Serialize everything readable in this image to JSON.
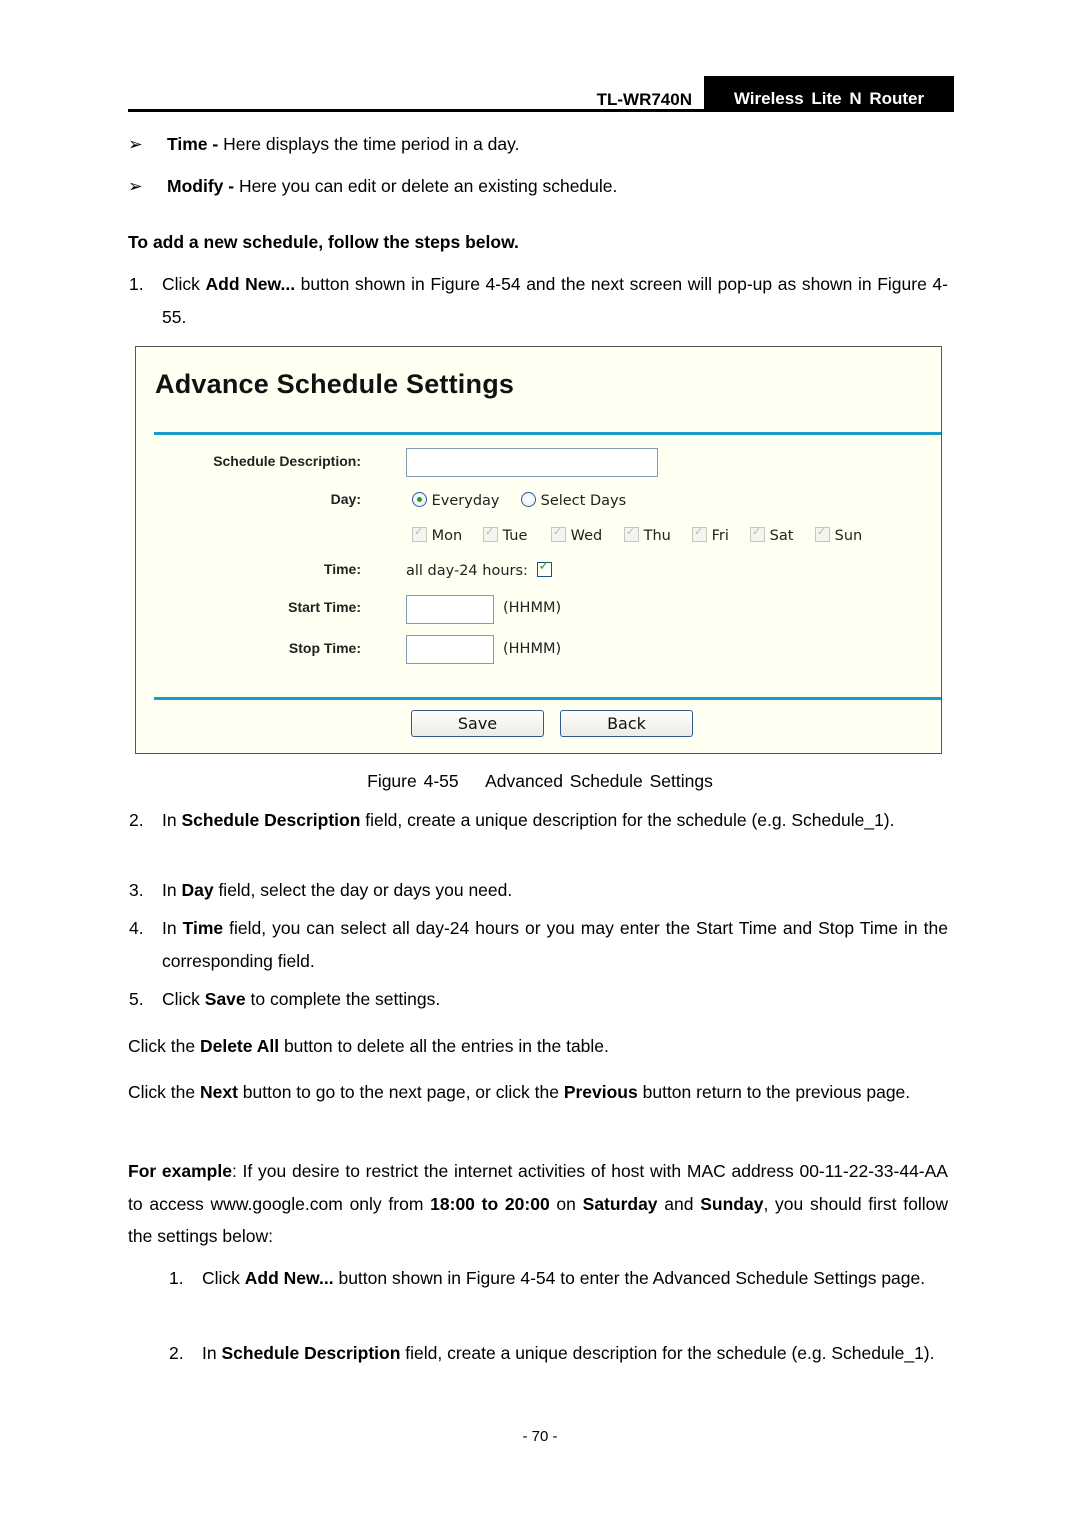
{
  "header": {
    "model": "TL-WR740N",
    "product": "Wireless  Lite  N  Router"
  },
  "bullets": [
    {
      "icon": "arrow-bullet-icon",
      "term": "Time -",
      "text": " Here displays the time period in a day."
    },
    {
      "icon": "arrow-bullet-icon",
      "term": "Modify -",
      "text": " Here you can edit or delete an existing schedule."
    }
  ],
  "section_heading": "To add a new schedule, follow the steps below.",
  "steps": [
    {
      "num": "1.",
      "parts": [
        "Click ",
        "Add New...",
        " button shown in Figure 4-54 and the next screen will pop-up as shown in Figure 4-55."
      ]
    },
    {
      "num": "2.",
      "parts": [
        "In ",
        "Schedule Description",
        " field, create a unique description for the schedule (e.g. Schedule_1)."
      ]
    },
    {
      "num": "3.",
      "parts": [
        "In ",
        "Day",
        " field, select the day or days you need."
      ]
    },
    {
      "num": "4.",
      "parts": [
        "In ",
        "Time",
        " field, you can select all day-24 hours or you may enter the Start Time and Stop Time in the corresponding field."
      ]
    },
    {
      "num": "5.",
      "parts": [
        "Click ",
        "Save",
        " to complete the settings."
      ]
    }
  ],
  "figure": {
    "title": "Advance Schedule Settings",
    "labels": {
      "description": "Schedule Description:",
      "day": "Day:",
      "time": "Time:",
      "start": "Start Time:",
      "stop": "Stop Time:"
    },
    "description_value": "",
    "day_options": [
      {
        "label": "Everyday",
        "selected": true
      },
      {
        "label": "Select Days",
        "selected": false
      }
    ],
    "days": [
      {
        "label": "Mon",
        "checked": true,
        "disabled": true
      },
      {
        "label": "Tue",
        "checked": true,
        "disabled": true
      },
      {
        "label": "Wed",
        "checked": true,
        "disabled": true
      },
      {
        "label": "Thu",
        "checked": true,
        "disabled": true
      },
      {
        "label": "Fri",
        "checked": true,
        "disabled": true
      },
      {
        "label": "Sat",
        "checked": true,
        "disabled": true
      },
      {
        "label": "Sun",
        "checked": true,
        "disabled": true
      }
    ],
    "all_day_label": "all day-24 hours:",
    "all_day_checked": true,
    "start_value": "",
    "stop_value": "",
    "time_format_hint": "(HHMM)",
    "buttons": {
      "save": "Save",
      "back": "Back"
    },
    "colors": {
      "background": "#fffff2",
      "divider": "#1a9bc9"
    }
  },
  "caption": "Figure 4-55    Advanced Schedule Settings",
  "paragraphs": {
    "delete_all": [
      "Click the ",
      "Delete All",
      " button to delete all the entries in the table."
    ],
    "next_prev": [
      "Click the ",
      "Next",
      " button to go to the next page, or click the ",
      "Previous",
      " button return to the previous page."
    ],
    "example": [
      "For example",
      ": If you desire to restrict the internet activities of host with MAC address 00-11-22-33-44-AA to access www.google.com only from ",
      "18:00 to 20:00",
      " on ",
      "Saturday",
      " and ",
      "Sunday",
      ", you should first follow the settings below:"
    ]
  },
  "example_steps": [
    {
      "num": "1.",
      "parts": [
        "Click ",
        "Add New...",
        " button shown in Figure 4-54 to enter the Advanced Schedule Settings page."
      ]
    },
    {
      "num": "2.",
      "parts": [
        "In ",
        "Schedule Description",
        " field, create a unique description for the schedule (e.g. Schedule_1)."
      ]
    }
  ],
  "page_number": "- 70 -"
}
